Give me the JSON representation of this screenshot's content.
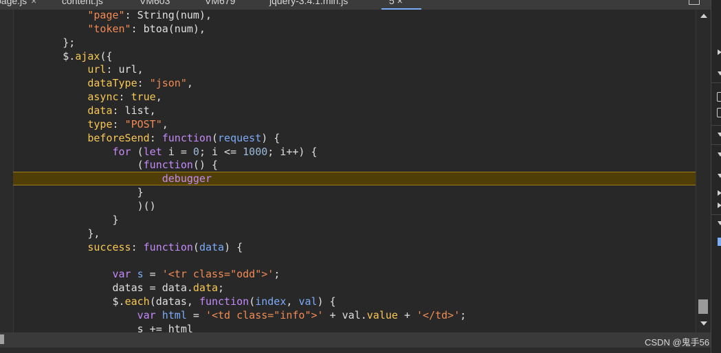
{
  "tabs": [
    {
      "label": "page.js",
      "close": "×"
    },
    {
      "label": "content.js"
    },
    {
      "label": "VM603"
    },
    {
      "label": "VM679"
    },
    {
      "label": "jquery-3.4.1.min.js"
    },
    {
      "label": "5 ×"
    }
  ],
  "code_lines": [
    {
      "paused": false,
      "tokens": [
        {
          "t": "str",
          "v": "            \"page\""
        },
        {
          "t": "txt",
          "v": ": String(num),"
        }
      ]
    },
    {
      "paused": false,
      "tokens": [
        {
          "t": "str",
          "v": "            \"token\""
        },
        {
          "t": "txt",
          "v": ": btoa(num),"
        }
      ]
    },
    {
      "paused": false,
      "tokens": [
        {
          "t": "txt",
          "v": "        };"
        }
      ]
    },
    {
      "paused": false,
      "tokens": [
        {
          "t": "txt",
          "v": "        $."
        },
        {
          "t": "prop",
          "v": "ajax"
        },
        {
          "t": "txt",
          "v": "({"
        }
      ]
    },
    {
      "paused": false,
      "tokens": [
        {
          "t": "prop",
          "v": "            url"
        },
        {
          "t": "txt",
          "v": ": url,"
        }
      ]
    },
    {
      "paused": false,
      "tokens": [
        {
          "t": "prop",
          "v": "            dataType"
        },
        {
          "t": "txt",
          "v": ": "
        },
        {
          "t": "str",
          "v": "\"json\""
        },
        {
          "t": "txt",
          "v": ","
        }
      ]
    },
    {
      "paused": false,
      "tokens": [
        {
          "t": "prop",
          "v": "            async"
        },
        {
          "t": "txt",
          "v": ": "
        },
        {
          "t": "prop",
          "v": "true"
        },
        {
          "t": "txt",
          "v": ","
        }
      ]
    },
    {
      "paused": false,
      "tokens": [
        {
          "t": "prop",
          "v": "            data"
        },
        {
          "t": "txt",
          "v": ": list,"
        }
      ]
    },
    {
      "paused": false,
      "tokens": [
        {
          "t": "prop",
          "v": "            type"
        },
        {
          "t": "txt",
          "v": ": "
        },
        {
          "t": "str",
          "v": "\"POST\""
        },
        {
          "t": "txt",
          "v": ","
        }
      ]
    },
    {
      "paused": false,
      "tokens": [
        {
          "t": "prop",
          "v": "            beforeSend"
        },
        {
          "t": "txt",
          "v": ": "
        },
        {
          "t": "kw",
          "v": "function"
        },
        {
          "t": "txt",
          "v": "("
        },
        {
          "t": "var",
          "v": "request"
        },
        {
          "t": "txt",
          "v": ") {"
        }
      ]
    },
    {
      "paused": false,
      "tokens": [
        {
          "t": "kw",
          "v": "                for"
        },
        {
          "t": "txt",
          "v": " ("
        },
        {
          "t": "kw",
          "v": "let"
        },
        {
          "t": "txt",
          "v": " i = "
        },
        {
          "t": "num",
          "v": "0"
        },
        {
          "t": "txt",
          "v": "; i <= "
        },
        {
          "t": "num",
          "v": "1000"
        },
        {
          "t": "txt",
          "v": "; i++) {"
        }
      ]
    },
    {
      "paused": false,
      "tokens": [
        {
          "t": "txt",
          "v": "                    ("
        },
        {
          "t": "kw",
          "v": "function"
        },
        {
          "t": "txt",
          "v": "() {"
        }
      ]
    },
    {
      "paused": true,
      "tokens": [
        {
          "t": "dbg",
          "v": "                        debugger"
        }
      ]
    },
    {
      "paused": false,
      "tokens": [
        {
          "t": "txt",
          "v": "                    }"
        }
      ]
    },
    {
      "paused": false,
      "tokens": [
        {
          "t": "txt",
          "v": "                    )()"
        }
      ]
    },
    {
      "paused": false,
      "tokens": [
        {
          "t": "txt",
          "v": "                }"
        }
      ]
    },
    {
      "paused": false,
      "tokens": [
        {
          "t": "txt",
          "v": "            },"
        }
      ]
    },
    {
      "paused": false,
      "tokens": [
        {
          "t": "prop",
          "v": "            success"
        },
        {
          "t": "txt",
          "v": ": "
        },
        {
          "t": "kw",
          "v": "function"
        },
        {
          "t": "txt",
          "v": "("
        },
        {
          "t": "var",
          "v": "data"
        },
        {
          "t": "txt",
          "v": ") {"
        }
      ]
    },
    {
      "paused": false,
      "tokens": [
        {
          "t": "txt",
          "v": ""
        }
      ]
    },
    {
      "paused": false,
      "tokens": [
        {
          "t": "kw",
          "v": "                var"
        },
        {
          "t": "txt",
          "v": " "
        },
        {
          "t": "var",
          "v": "s"
        },
        {
          "t": "txt",
          "v": " = "
        },
        {
          "t": "str",
          "v": "'<tr class=\"odd\">'"
        },
        {
          "t": "txt",
          "v": ";"
        }
      ]
    },
    {
      "paused": false,
      "tokens": [
        {
          "t": "txt",
          "v": "                datas = data."
        },
        {
          "t": "prop",
          "v": "data"
        },
        {
          "t": "txt",
          "v": ";"
        }
      ]
    },
    {
      "paused": false,
      "tokens": [
        {
          "t": "txt",
          "v": "                $."
        },
        {
          "t": "prop",
          "v": "each"
        },
        {
          "t": "txt",
          "v": "(datas, "
        },
        {
          "t": "kw",
          "v": "function"
        },
        {
          "t": "txt",
          "v": "("
        },
        {
          "t": "var",
          "v": "index"
        },
        {
          "t": "txt",
          "v": ", "
        },
        {
          "t": "var",
          "v": "val"
        },
        {
          "t": "txt",
          "v": ") {"
        }
      ]
    },
    {
      "paused": false,
      "tokens": [
        {
          "t": "kw",
          "v": "                    var"
        },
        {
          "t": "txt",
          "v": " "
        },
        {
          "t": "var",
          "v": "html"
        },
        {
          "t": "txt",
          "v": " = "
        },
        {
          "t": "str",
          "v": "'<td class=\"info\">'"
        },
        {
          "t": "txt",
          "v": " + val."
        },
        {
          "t": "prop",
          "v": "value"
        },
        {
          "t": "txt",
          "v": " + "
        },
        {
          "t": "str",
          "v": "'</td>'"
        },
        {
          "t": "txt",
          "v": ";"
        }
      ]
    },
    {
      "paused": false,
      "tokens": [
        {
          "t": "txt",
          "v": "                    s += html"
        }
      ]
    },
    {
      "paused": false,
      "tokens": [
        {
          "t": "txt",
          "v": "                });"
        }
      ]
    }
  ],
  "watermark": "CSDN @鬼手56",
  "colors": {
    "background": "#282828",
    "paused_line": "#4f3f06",
    "paused_border": "#a17d14",
    "string": "#f28b54",
    "keyword": "#c58af9",
    "property": "#f8c855",
    "number": "#9bbbdc",
    "variable": "#7cacf8",
    "text": "#e0e0e0"
  }
}
